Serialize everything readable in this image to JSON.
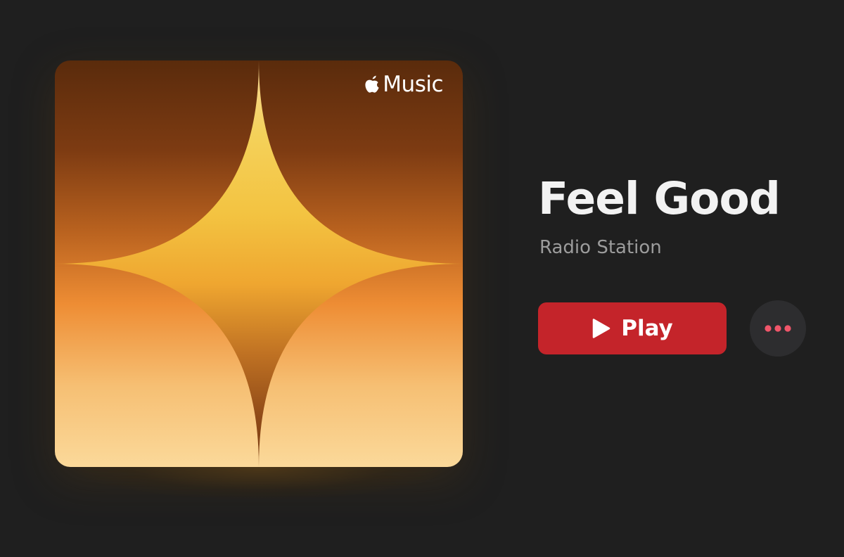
{
  "artwork": {
    "brand_label": "Music",
    "icon": "apple-logo-icon"
  },
  "station": {
    "title": "Feel Good",
    "subtitle": "Radio Station"
  },
  "actions": {
    "play_label": "Play",
    "play_icon": "play-icon",
    "more_icon": "ellipsis-icon"
  },
  "colors": {
    "background": "#1f1f1f",
    "play_button": "#c4242a",
    "more_button": "#2d2d2f",
    "more_dots": "#f0566a",
    "title_text": "#f2f2f2",
    "subtitle_text": "#9c9c9c"
  }
}
